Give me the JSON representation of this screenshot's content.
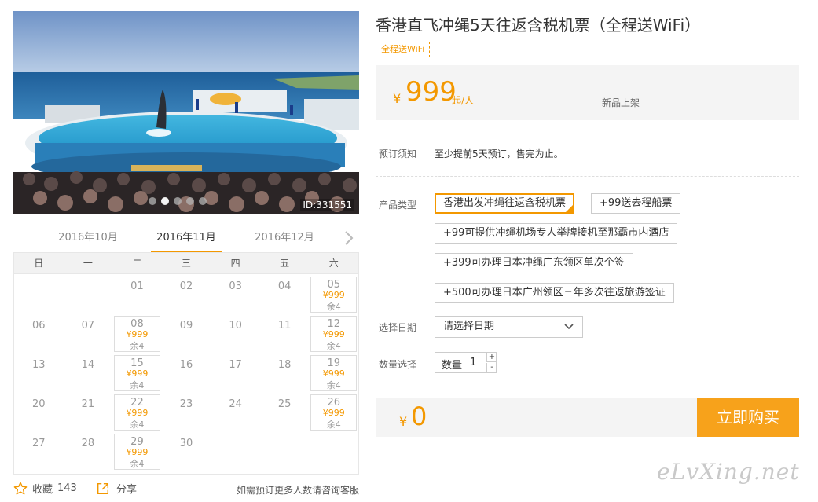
{
  "hero": {
    "image_id": "ID:331551",
    "slide_count": 5,
    "active_slide": 1
  },
  "months": {
    "tabs": [
      "2016年10月",
      "2016年11月",
      "2016年12月"
    ],
    "active_index": 1
  },
  "calendar": {
    "weekdays": [
      "日",
      "一",
      "二",
      "三",
      "四",
      "五",
      "六"
    ],
    "weeks": [
      [
        null,
        null,
        {
          "d": "01"
        },
        {
          "d": "02"
        },
        {
          "d": "03"
        },
        {
          "d": "04"
        },
        {
          "d": "05",
          "price": "¥999",
          "stock": "余4"
        }
      ],
      [
        {
          "d": "06"
        },
        {
          "d": "07"
        },
        {
          "d": "08",
          "price": "¥999",
          "stock": "余4"
        },
        {
          "d": "09"
        },
        {
          "d": "10"
        },
        {
          "d": "11"
        },
        {
          "d": "12",
          "price": "¥999",
          "stock": "余4"
        }
      ],
      [
        {
          "d": "13"
        },
        {
          "d": "14"
        },
        {
          "d": "15",
          "price": "¥999",
          "stock": "余4"
        },
        {
          "d": "16"
        },
        {
          "d": "17"
        },
        {
          "d": "18"
        },
        {
          "d": "19",
          "price": "¥999",
          "stock": "余4"
        }
      ],
      [
        {
          "d": "20"
        },
        {
          "d": "21"
        },
        {
          "d": "22",
          "price": "¥999",
          "stock": "余4"
        },
        {
          "d": "23"
        },
        {
          "d": "24"
        },
        {
          "d": "25"
        },
        {
          "d": "26",
          "price": "¥999",
          "stock": "余4"
        }
      ],
      [
        {
          "d": "27"
        },
        {
          "d": "28"
        },
        {
          "d": "29",
          "price": "¥999",
          "stock": "余4"
        },
        {
          "d": "30"
        },
        null,
        null,
        null
      ]
    ]
  },
  "bottom": {
    "fav_label": "收藏",
    "fav_count": "143",
    "share_label": "分享",
    "tip": "如需预订更多人数请咨询客服"
  },
  "product": {
    "title": "香港直飞冲绳5天往返含税机票（全程送WiFi）",
    "tag": "全程送WiFi",
    "price_symbol": "¥",
    "price": "999",
    "price_unit": "起/人",
    "new_tag": "新品上架"
  },
  "booking": {
    "notice_label": "预订须知",
    "notice_text": "至少提前5天预订，售完为止。",
    "type_label": "产品类型",
    "options": [
      "香港出发冲绳往返含税机票",
      "+99送去程船票",
      "+99可提供冲绳机场专人举牌接机至那霸市内酒店",
      "+399可办理日本冲绳广东领区单次个签",
      "+500可办理日本广州领区三年多次往返旅游签证"
    ],
    "selected_option": 0,
    "date_label": "选择日期",
    "date_placeholder": "请选择日期",
    "qty_label": "数量选择",
    "qty_prefix": "数量",
    "qty_value": "1",
    "qty_plus": "+",
    "qty_minus": "-",
    "total_symbol": "¥",
    "total": "0",
    "buy_label": "立即购买"
  },
  "watermark": "eLvXing.net",
  "colors": {
    "accent": "#f39800",
    "buy_button": "#f7a21b",
    "panel_bg": "#f4f4f4"
  }
}
